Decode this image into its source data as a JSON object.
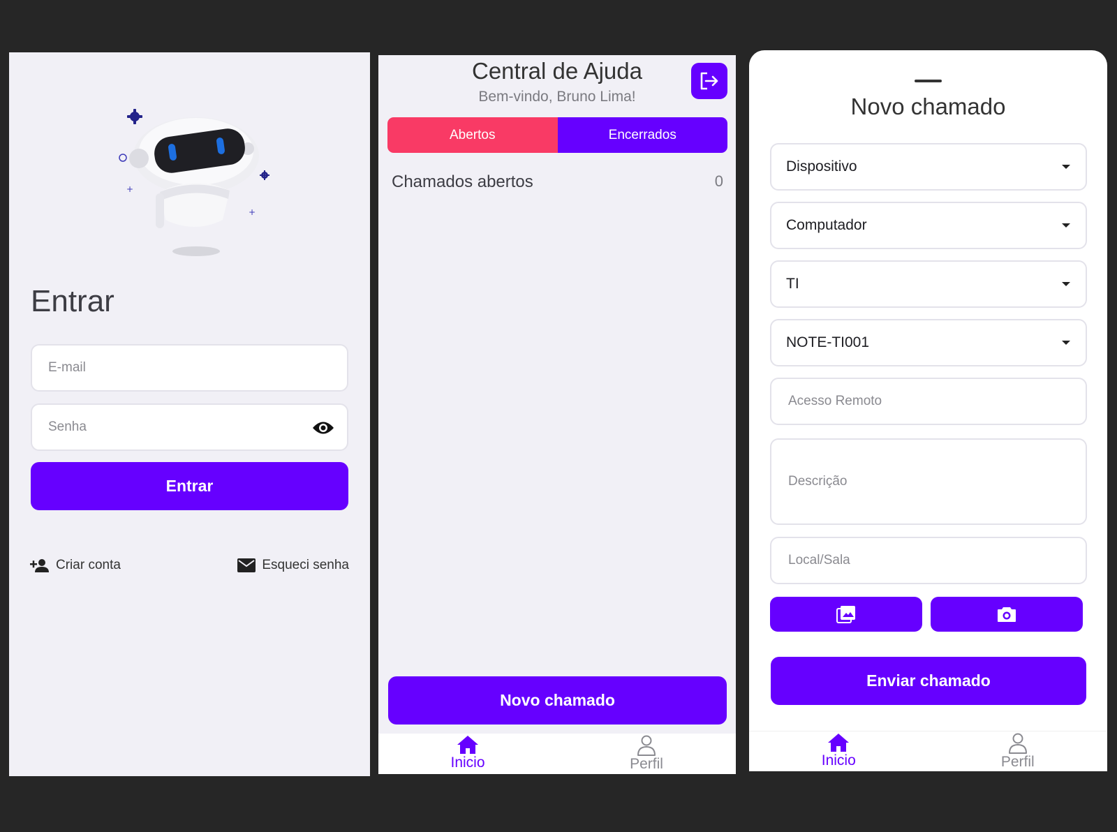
{
  "login": {
    "title": "Entrar",
    "email_placeholder": "E-mail",
    "password_placeholder": "Senha",
    "submit_label": "Entrar",
    "create_account_label": "Criar conta",
    "forgot_password_label": "Esqueci senha"
  },
  "home": {
    "title": "Central de Ajuda",
    "subtitle": "Bem-vindo, Bruno Lima!",
    "tabs": [
      {
        "label": "Abertos",
        "color": "#f93a65"
      },
      {
        "label": "Encerrados",
        "color": "#6600ff"
      }
    ],
    "section_label": "Chamados abertos",
    "count": "0",
    "new_ticket_label": "Novo chamado"
  },
  "new_ticket": {
    "title": "Novo chamado",
    "selects": [
      {
        "value": "Dispositivo"
      },
      {
        "value": "Computador"
      },
      {
        "value": "TI"
      },
      {
        "value": "NOTE-TI001"
      }
    ],
    "remote_access_placeholder": "Acesso Remoto",
    "description_placeholder": "Descrição",
    "location_placeholder": "Local/Sala",
    "gallery_icon": "image-icon",
    "camera_icon": "camera-icon",
    "submit_label": "Enviar chamado"
  },
  "nav": {
    "home_label": "Inicio",
    "profile_label": "Perfil",
    "home_icon": "home-icon",
    "profile_icon": "person-icon"
  },
  "colors": {
    "primary": "#6600ff",
    "accent": "#f93a65",
    "background": "#f1f0f6",
    "frame": "#262626"
  }
}
